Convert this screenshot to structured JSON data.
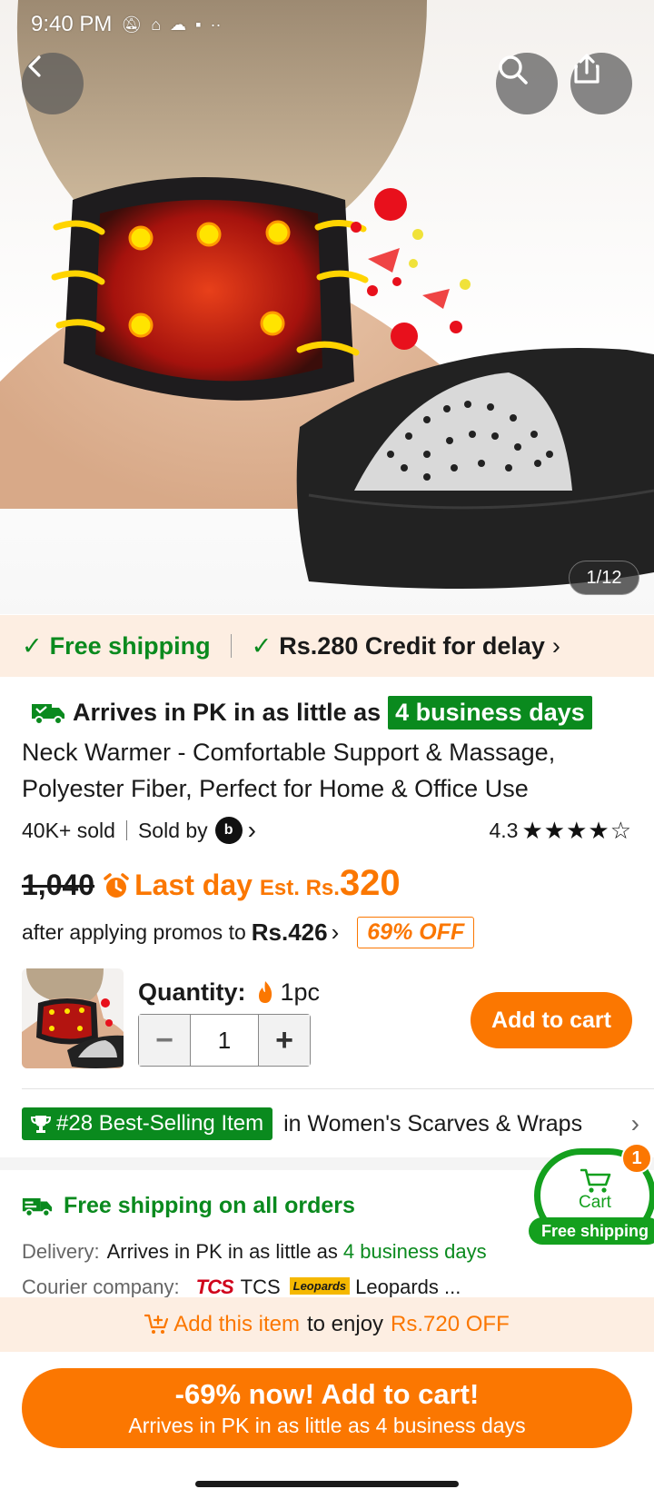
{
  "status_bar": {
    "time": "9:40 PM",
    "icons": [
      "bell-off-icon",
      "gamepad-icon",
      "cloud-icon",
      "temu-icon",
      "more-dots-icon"
    ]
  },
  "gallery": {
    "counter": "1/12"
  },
  "shipping_bar": {
    "free_shipping": "Free shipping",
    "credit": "Rs.280 Credit for delay"
  },
  "product": {
    "arrive_prefix": "Arrives in PK in as little as",
    "arrive_days": "4 business days",
    "title": "Neck Warmer - Comfortable Support & Massage, Polyester Fiber, Perfect for Home & Office Use",
    "sold": "40K+ sold",
    "sold_by": "Sold by",
    "rating": "4.3",
    "rating_value": 4.3,
    "original_price": "1,040",
    "last_day": "Last day",
    "est_label": "Est. Rs.",
    "est_price": "320",
    "after_promos": "after applying promos to",
    "promo_price": "Rs.426",
    "discount_badge": "69% OFF"
  },
  "purchase": {
    "quantity_label": "Quantity:",
    "pack": "1pc",
    "minus": "−",
    "quantity": "1",
    "plus": "+",
    "add_to_cart": "Add to cart"
  },
  "ranking": {
    "badge": "#28 Best-Selling Item",
    "category": "in Women's Scarves & Wraps"
  },
  "delivery": {
    "free_all": "Free shipping on all orders",
    "label": "Delivery:",
    "text": "Arrives in PK in as little as",
    "days": "4 business days",
    "courier_label": "Courier company:",
    "courier_tcs_logo": "TCS",
    "courier_tcs": "TCS",
    "courier_leopards_logo": "Leopards",
    "courier_leopards": "Leopards ..."
  },
  "cart_bubble": {
    "label": "Cart",
    "count": "1",
    "note": "Free shipping"
  },
  "promo_strip": {
    "add_item": "Add this item",
    "to_enjoy": "to enjoy",
    "amount": "Rs.720 OFF"
  },
  "cta": {
    "line1": "-69% now! Add to cart!",
    "line2": "Arrives in PK in as little as 4 business days"
  },
  "colors": {
    "accent_orange": "#fb7701",
    "accent_green": "#0a8a1e",
    "promo_bg": "#fdeee2"
  }
}
